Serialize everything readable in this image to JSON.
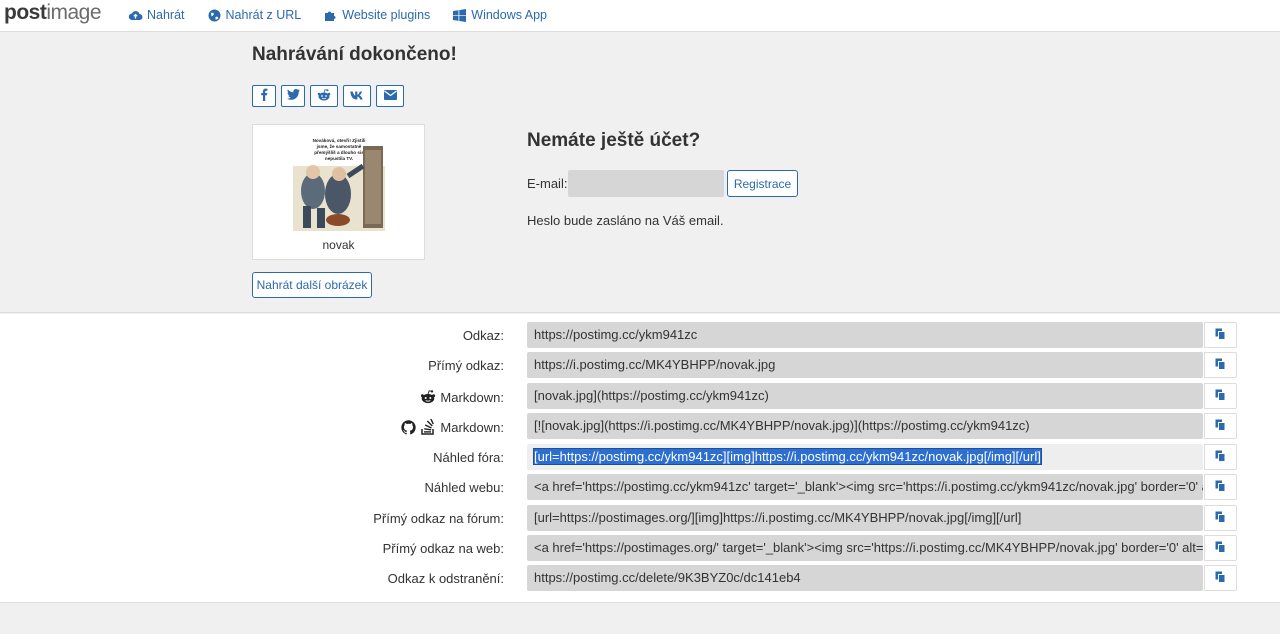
{
  "logo": {
    "post": "post",
    "image": "image"
  },
  "nav": [
    {
      "label": "Nahrát",
      "icon": "cloud-upload-icon"
    },
    {
      "label": "Nahrát z URL",
      "icon": "globe-icon"
    },
    {
      "label": "Website plugins",
      "icon": "puzzle-icon"
    },
    {
      "label": "Windows App",
      "icon": "windows-icon"
    }
  ],
  "upload": {
    "title": "Nahrávání dokončeno!",
    "share": [
      "facebook-icon",
      "twitter-icon",
      "reddit-icon",
      "vk-icon",
      "email-icon"
    ],
    "image_name": "novak",
    "thumb_text": "Nováková, otevři! Zjistili jsme, že samostatně přemýšlíš a dlouho sis nepustila TV.",
    "more_button": "Nahrát další obrázek"
  },
  "account": {
    "title": "Nemáte ještě účet?",
    "email_label": "E-mail:",
    "email_value": "",
    "register_button": "Registrace",
    "note": "Heslo bude zasláno na Váš email."
  },
  "links": [
    {
      "label": "Odkaz:",
      "value": "https://postimg.cc/ykm941zc"
    },
    {
      "label": "Přímý odkaz:",
      "value": "https://i.postimg.cc/MK4YBHPP/novak.jpg"
    },
    {
      "label": "Markdown:",
      "value": "[novak.jpg](https://postimg.cc/ykm941zc)",
      "icons": [
        "reddit-icon"
      ]
    },
    {
      "label": "Markdown:",
      "value": "[![novak.jpg](https://i.postimg.cc/MK4YBHPP/novak.jpg)](https://postimg.cc/ykm941zc)",
      "icons": [
        "github-icon",
        "stackoverflow-icon"
      ]
    },
    {
      "label": "Náhled fóra:",
      "value": "[url=https://postimg.cc/ykm941zc][img]https://i.postimg.cc/ykm941zc/novak.jpg[/img][/url]",
      "selected": true
    },
    {
      "label": "Náhled webu:",
      "value": "<a href='https://postimg.cc/ykm941zc' target='_blank'><img src='https://i.postimg.cc/ykm941zc/novak.jpg' border='0' alt"
    },
    {
      "label": "Přímý odkaz na fórum:",
      "value": "[url=https://postimages.org/][img]https://i.postimg.cc/MK4YBHPP/novak.jpg[/img][/url]"
    },
    {
      "label": "Přímý odkaz na web:",
      "value": "<a href='https://postimages.org/' target='_blank'><img src='https://i.postimg.cc/MK4YBHPP/novak.jpg' border='0' alt='no"
    },
    {
      "label": "Odkaz k odstranění:",
      "value": "https://postimg.cc/delete/9K3BYZ0c/dc141eb4"
    }
  ],
  "colors": {
    "accent": "#2b6aad",
    "field": "#d6d6d6",
    "selection": "#2d6fd1"
  }
}
